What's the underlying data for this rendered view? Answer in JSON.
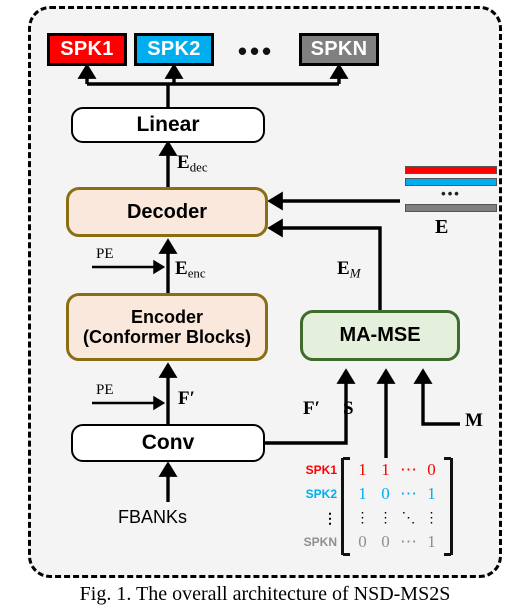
{
  "figure": {
    "caption": "Fig. 1. The overall architecture of NSD-MS2S"
  },
  "speakers": {
    "items": [
      {
        "label": "SPK1",
        "color": "#ff0000"
      },
      {
        "label": "SPK2",
        "color": "#00aeef"
      },
      {
        "label": "SPKN",
        "color": "#808080"
      }
    ],
    "ellipsis": "•••"
  },
  "blocks": {
    "linear": "Linear",
    "decoder": "Decoder",
    "encoder_line1": "Encoder",
    "encoder_line2": "(Conformer Blocks)",
    "mamse": "MA-MSE",
    "conv": "Conv"
  },
  "labels": {
    "e_dec": "E",
    "e_dec_sub": "dec",
    "e_enc": "E",
    "e_enc_sub": "enc",
    "e_m": "E",
    "e_m_sub": "M",
    "e_stack": "E",
    "f_prime_1": "F′",
    "f_prime_2": "F′",
    "s": "S",
    "m": "M",
    "pe_1": "PE",
    "pe_2": "PE",
    "fbanks": "FBANKs",
    "estack_dots": "•••"
  },
  "matrix": {
    "row_labels": [
      "SPK1",
      "SPK2",
      "⋮",
      "SPKN"
    ],
    "rows": [
      [
        "1",
        "1",
        "⋯",
        "0"
      ],
      [
        "1",
        "0",
        "⋯",
        "1"
      ],
      [
        "⋮",
        "⋮",
        "⋱",
        "⋮"
      ],
      [
        "0",
        "0",
        "⋯",
        "1"
      ]
    ],
    "row_colors": [
      "#ff0000",
      "#00aeef",
      "#000000",
      "#8f8f8f"
    ]
  },
  "colors": {
    "spk1": "#ff0000",
    "spk2": "#00aeef",
    "spkn": "#808080",
    "tan_fill": "#fae8dc",
    "tan_border": "#8a6d15",
    "green_fill": "#e5f0dc",
    "green_border": "#3f6b2b",
    "panel_bg": "#f4f4f4"
  }
}
